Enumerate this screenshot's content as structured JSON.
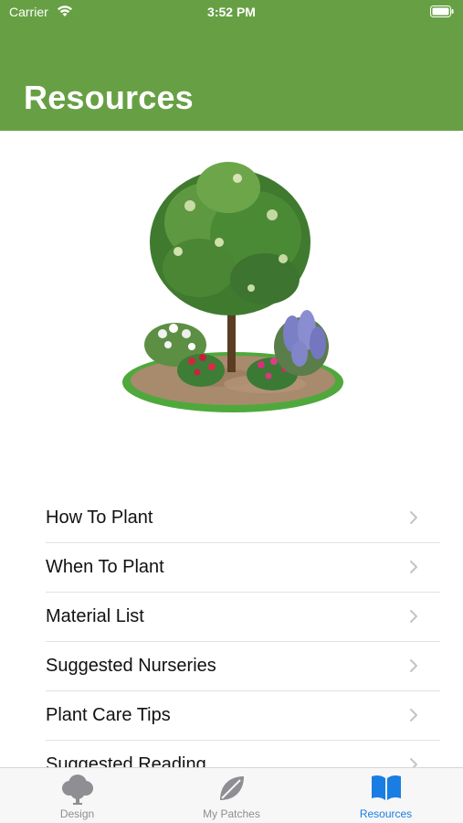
{
  "status_bar": {
    "carrier": "Carrier",
    "time": "3:52 PM"
  },
  "header": {
    "title": "Resources",
    "color": "#67a044"
  },
  "hero": {
    "illustration": "tree-garden-patch-illustration"
  },
  "list": {
    "items": [
      {
        "label": "How To Plant"
      },
      {
        "label": "When To Plant"
      },
      {
        "label": "Material List"
      },
      {
        "label": "Suggested Nurseries"
      },
      {
        "label": "Plant Care Tips"
      },
      {
        "label": "Suggested Reading"
      }
    ]
  },
  "tabbar": {
    "active_color": "#1a7de3",
    "inactive_color": "#8e8e93",
    "tabs": [
      {
        "label": "Design",
        "icon": "tree-icon"
      },
      {
        "label": "My Patches",
        "icon": "leaf-icon"
      },
      {
        "label": "Resources",
        "icon": "book-icon",
        "active": true
      }
    ]
  }
}
